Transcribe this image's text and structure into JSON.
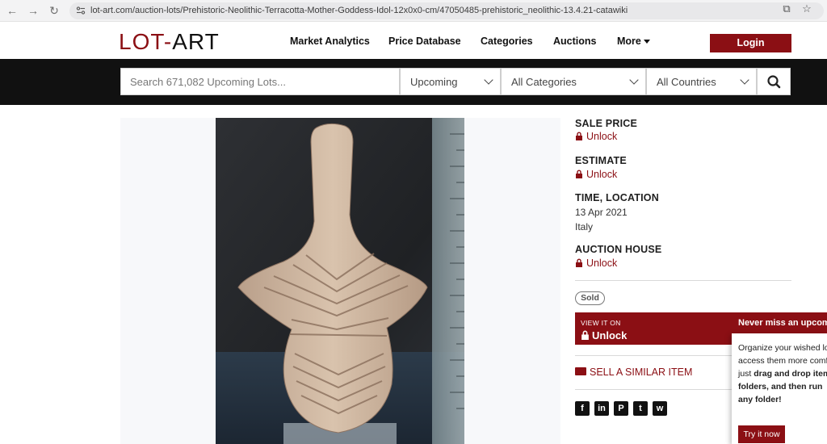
{
  "browser": {
    "back_icon": "arrow-left-icon",
    "forward_icon": "arrow-right-icon",
    "reload_icon": "reload-icon",
    "url": "lot-art.com/auction-lots/Prehistoric-Neolithic-Terracotta-Mother-Goddess-Idol-12x0x0-cm/47050485-prehistoric_neolithic-13.4.21-catawiki"
  },
  "header": {
    "logo_lot": "LOT",
    "logo_dash": "-",
    "logo_art": "ART",
    "nav": [
      "Market Analytics",
      "Price Database",
      "Categories",
      "Auctions",
      "More"
    ],
    "login_label": "Login"
  },
  "search": {
    "placeholder": "Search 671,082 Upcoming Lots...",
    "status_selected": "Upcoming",
    "category_selected": "All Categories",
    "country_selected": "All Countries"
  },
  "details": {
    "sale_price_label": "SALE PRICE",
    "sale_price_value": "Unlock",
    "estimate_label": "ESTIMATE",
    "estimate_value": "Unlock",
    "time_location_label": "TIME, LOCATION",
    "date": "13 Apr 2021",
    "location": "Italy",
    "auction_house_label": "AUCTION HOUSE",
    "auction_house_value": "Unlock",
    "status_badge": "Sold",
    "view_it_on_label": "VIEW IT ON",
    "view_it_on_value": "Unlock",
    "sell_similar_label": "SELL A SIMILAR ITEM"
  },
  "social": [
    {
      "name": "facebook-icon",
      "glyph": "f"
    },
    {
      "name": "linkedin-icon",
      "glyph": "in"
    },
    {
      "name": "pinterest-icon",
      "glyph": "P"
    },
    {
      "name": "twitter-icon",
      "glyph": "t"
    },
    {
      "name": "whatsapp-icon",
      "glyph": "w"
    }
  ],
  "popup": {
    "title": "Never miss an upcomi",
    "line1": "Organize your wished lo",
    "line2": "access them more comf",
    "line3_plain": "just ",
    "line3_bold": "drag and drop item",
    "line4_bold": "folders",
    "line4_rest": ", and then run",
    "line5": "any folder!",
    "try_label": "Try it now"
  },
  "colors": {
    "brand": "#8b0f14",
    "search_band": "#111111"
  }
}
